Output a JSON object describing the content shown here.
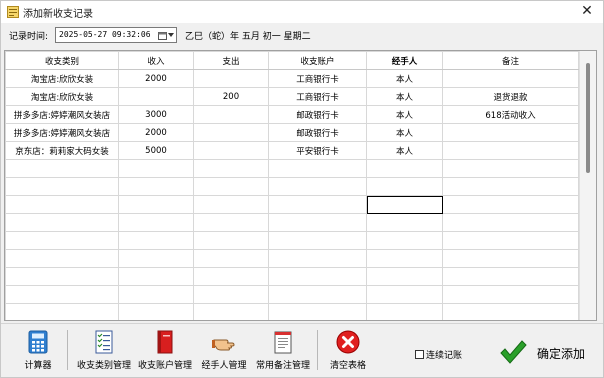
{
  "window": {
    "title": "添加新收支记录",
    "close_glyph": "✕"
  },
  "record": {
    "label": "记录时间:",
    "datetime": "2025-05-27 09:32:06",
    "lunar": "乙巳（蛇）年 五月 初一 星期二"
  },
  "table": {
    "headers": [
      "收支类别",
      "收入",
      "支出",
      "收支账户",
      "经手人",
      "备注"
    ],
    "rows": [
      [
        "淘宝店:欣欣女装",
        "2000",
        "",
        "工商银行卡",
        "本人",
        ""
      ],
      [
        "淘宝店:欣欣女装",
        "",
        "200",
        "工商银行卡",
        "本人",
        "退货退款"
      ],
      [
        "拼多多店:婷婷潮风女装店",
        "3000",
        "",
        "邮政银行卡",
        "本人",
        "618活动收入"
      ],
      [
        "拼多多店:婷婷潮风女装店",
        "2000",
        "",
        "邮政银行卡",
        "本人",
        ""
      ],
      [
        "京东店：莉莉家大码女装",
        "5000",
        "",
        "平安银行卡",
        "本人",
        ""
      ],
      [
        "",
        "",
        "",
        "",
        "",
        ""
      ],
      [
        "",
        "",
        "",
        "",
        "",
        ""
      ],
      [
        "",
        "",
        "",
        "",
        "",
        ""
      ],
      [
        "",
        "",
        "",
        "",
        "",
        ""
      ],
      [
        "",
        "",
        "",
        "",
        "",
        ""
      ],
      [
        "",
        "",
        "",
        "",
        "",
        ""
      ],
      [
        "",
        "",
        "",
        "",
        "",
        ""
      ],
      [
        "",
        "",
        "",
        "",
        "",
        ""
      ],
      [
        "",
        "",
        "",
        "",
        "",
        ""
      ],
      [
        "",
        "",
        "",
        "",
        "",
        ""
      ]
    ]
  },
  "toolbar": {
    "calculator": "计算器",
    "category_mgmt": "收支类别管理",
    "account_mgmt": "收支账户管理",
    "handler_mgmt": "经手人管理",
    "remark_mgmt": "常用备注管理",
    "clear_table": "清空表格",
    "continuous": "连续记账",
    "confirm": "确定添加"
  },
  "icons": {
    "app": "app-icon",
    "calendar": "calendar-icon",
    "calculator": "calculator-icon",
    "category": "checklist-icon",
    "account": "red-book-icon",
    "handler": "pointing-hand-icon",
    "remark": "notepad-icon",
    "clear": "red-x-icon",
    "confirm": "green-check-icon"
  },
  "colors": {
    "accent_red": "#e02020",
    "accent_green": "#2aa02a",
    "calc_blue": "#2f7fd0"
  }
}
